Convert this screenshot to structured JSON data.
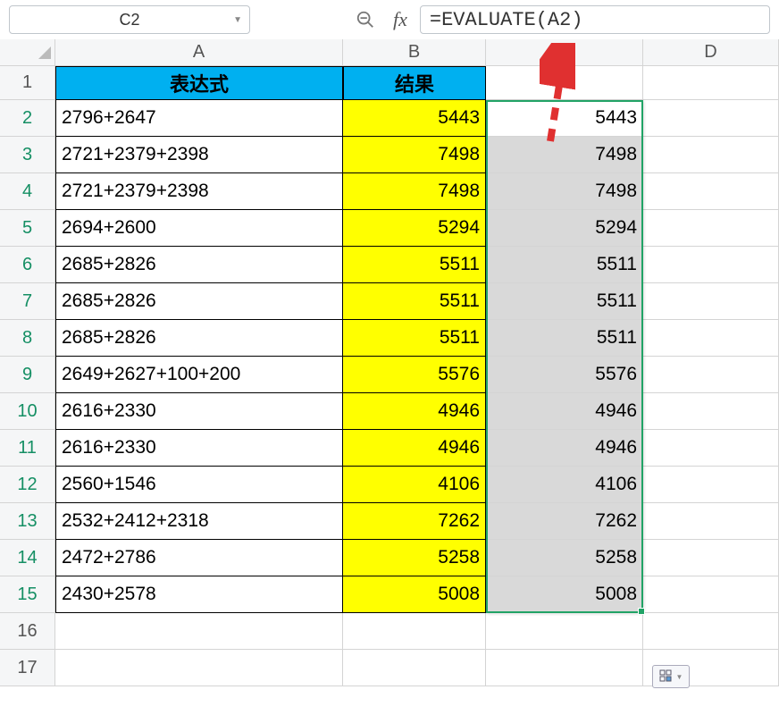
{
  "name_box": "C2",
  "formula": "=EVALUATE(A2)",
  "columns": [
    "A",
    "B",
    "C",
    "D"
  ],
  "header_row": {
    "A": "表达式",
    "B": "结果"
  },
  "rows": [
    {
      "n": 2,
      "A": "2796+2647",
      "B": "5443",
      "C": "5443"
    },
    {
      "n": 3,
      "A": "2721+2379+2398",
      "B": "7498",
      "C": "7498"
    },
    {
      "n": 4,
      "A": "2721+2379+2398",
      "B": "7498",
      "C": "7498"
    },
    {
      "n": 5,
      "A": "2694+2600",
      "B": "5294",
      "C": "5294"
    },
    {
      "n": 6,
      "A": "2685+2826",
      "B": "5511",
      "C": "5511"
    },
    {
      "n": 7,
      "A": "2685+2826",
      "B": "5511",
      "C": "5511"
    },
    {
      "n": 8,
      "A": "2685+2826",
      "B": "5511",
      "C": "5511"
    },
    {
      "n": 9,
      "A": "2649+2627+100+200",
      "B": "5576",
      "C": "5576"
    },
    {
      "n": 10,
      "A": "2616+2330",
      "B": "4946",
      "C": "4946"
    },
    {
      "n": 11,
      "A": "2616+2330",
      "B": "4946",
      "C": "4946"
    },
    {
      "n": 12,
      "A": "2560+1546",
      "B": "4106",
      "C": "4106"
    },
    {
      "n": 13,
      "A": "2532+2412+2318",
      "B": "7262",
      "C": "7262"
    },
    {
      "n": 14,
      "A": "2472+2786",
      "B": "5258",
      "C": "5258"
    },
    {
      "n": 15,
      "A": "2430+2578",
      "B": "5008",
      "C": "5008"
    }
  ],
  "empty_rows": [
    16,
    17
  ]
}
